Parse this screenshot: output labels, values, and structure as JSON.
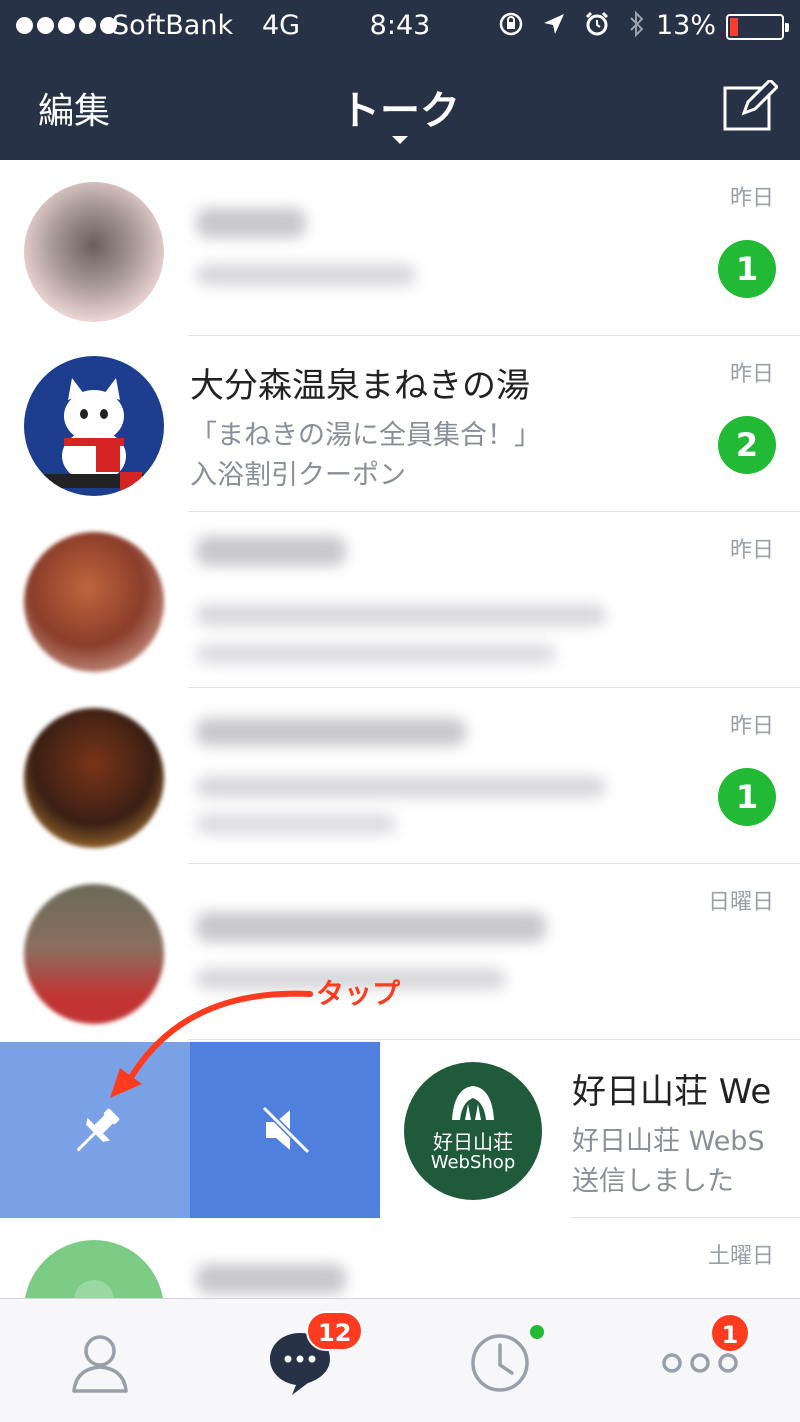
{
  "status_bar": {
    "carrier": "SoftBank",
    "network": "4G",
    "time": "8:43",
    "battery_percent": "13%"
  },
  "nav": {
    "edit_label": "編集",
    "title": "トーク"
  },
  "chats": [
    {
      "name": "",
      "preview": "",
      "time": "昨日",
      "badge": "1",
      "blurred": true
    },
    {
      "name": "大分森温泉まねきの湯",
      "preview_line1": "「まねきの湯に全員集合！」",
      "preview_line2": "入浴割引クーポン",
      "time": "昨日",
      "badge": "2",
      "blurred": false
    },
    {
      "name": "",
      "preview": "",
      "time": "昨日",
      "badge": "",
      "blurred": true
    },
    {
      "name": "",
      "preview": "",
      "time": "昨日",
      "badge": "1",
      "blurred": true
    },
    {
      "name": "",
      "preview": "",
      "time": "日曜日",
      "badge": "",
      "blurred": true
    },
    {
      "name": "好日山荘 We",
      "preview_line1": "好日山荘 WebS",
      "preview_line2": "送信しました",
      "time": "",
      "badge": "",
      "blurred": false,
      "swiped": true,
      "avatar_line1": "好日山荘",
      "avatar_line2": "WebShop"
    },
    {
      "name": "",
      "preview": "",
      "time": "土曜日",
      "badge": "",
      "blurred": true
    }
  ],
  "swipe_actions": [
    {
      "name": "pin",
      "icon": "pin-icon",
      "color": "#7aa0e5"
    },
    {
      "name": "mute",
      "icon": "mute-icon",
      "color": "#4f80de"
    }
  ],
  "annotation": {
    "label": "タップ",
    "color": "#ff3b1f"
  },
  "tabbar": {
    "items": [
      {
        "icon": "friends-icon",
        "badge": ""
      },
      {
        "icon": "chats-icon",
        "badge": "12",
        "active": true
      },
      {
        "icon": "timeline-icon",
        "badge": "",
        "dot": true
      },
      {
        "icon": "more-icon",
        "badge": "1"
      }
    ]
  },
  "colors": {
    "header": "#273247",
    "badge_green": "#22b934",
    "badge_red": "#ff3b1f"
  }
}
